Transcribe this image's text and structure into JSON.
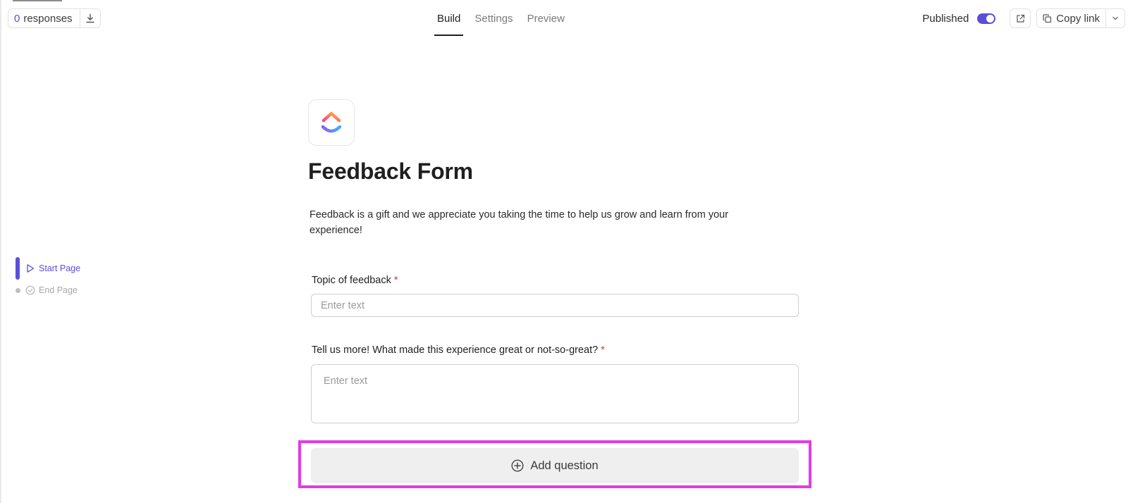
{
  "header": {
    "responses_count": "0",
    "responses_label": "responses",
    "tabs": [
      {
        "label": "Build",
        "active": true
      },
      {
        "label": "Settings",
        "active": false
      },
      {
        "label": "Preview",
        "active": false
      }
    ],
    "published_label": "Published",
    "published_on": true,
    "copy_link_label": "Copy link"
  },
  "pages": [
    {
      "label": "Start Page",
      "active": true
    },
    {
      "label": "End Page",
      "active": false
    }
  ],
  "form": {
    "title": "Feedback Form",
    "description": "Feedback is a gift and we appreciate you taking the time to help us grow and learn from your experience!",
    "questions": [
      {
        "label": "Topic of feedback",
        "required_mark": "*",
        "placeholder": "Enter text"
      },
      {
        "label": "Tell us more! What made this experience great or not-so-great?",
        "required_mark": "*",
        "placeholder": "Enter text"
      }
    ],
    "add_question_label": "Add question"
  },
  "colors": {
    "accent": "#5b4fd6",
    "required": "#d4372c",
    "highlight": "#e23be3"
  }
}
